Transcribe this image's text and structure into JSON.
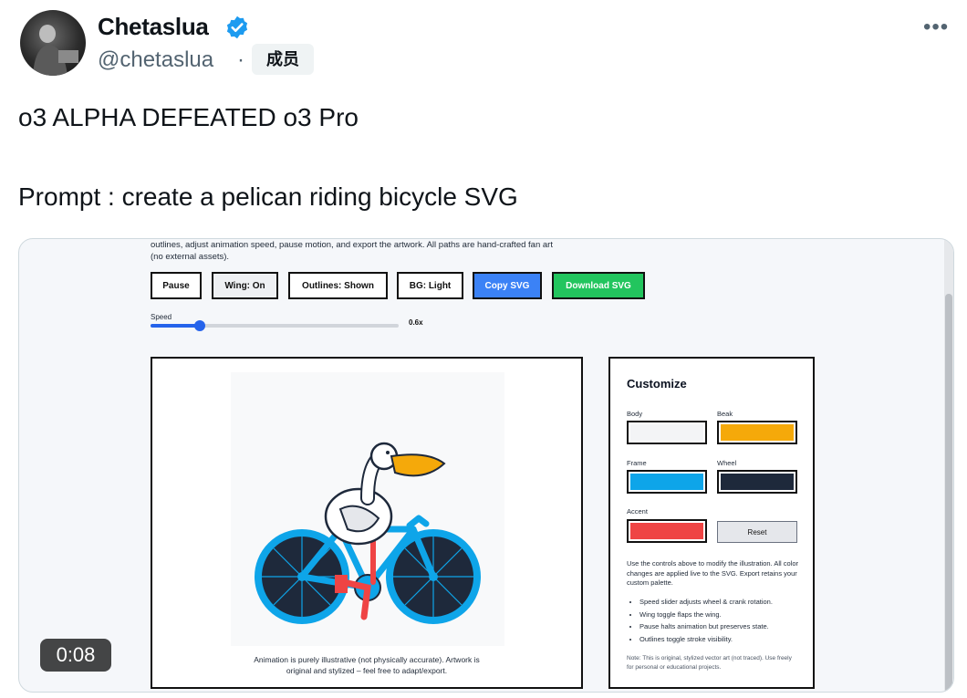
{
  "author": {
    "name": "Chetaslua",
    "handle": "@chetaslua",
    "separator": "·",
    "badge": "成员",
    "verified_color": "#1d9bf0"
  },
  "more_label": "•••",
  "tweet": {
    "line1": "o3 ALPHA DEFEATED o3 Pro",
    "line2": "Prompt : create a pelican riding bicycle SVG"
  },
  "video": {
    "timer": "0:08",
    "intro_text": "outlines, adjust animation speed, pause motion, and export the artwork. All paths are hand-crafted fan art (no external assets).",
    "buttons": {
      "pause": "Pause",
      "wing": "Wing: On",
      "outlines": "Outlines: Shown",
      "bg": "BG: Light",
      "copy": "Copy SVG",
      "download": "Download SVG"
    },
    "button_colors": {
      "copy": "#3b82f6",
      "download": "#22c55e"
    },
    "speed_label": "Speed",
    "speed_value": "0.6x",
    "speed_fraction": 0.2,
    "caption": "Animation is purely illustrative (not physically accurate). Artwork is original and stylized – feel free to adapt/export.",
    "customize": {
      "title": "Customize",
      "body_label": "Body",
      "beak_label": "Beak",
      "frame_label": "Frame",
      "wheel_label": "Wheel",
      "accent_label": "Accent",
      "reset": "Reset",
      "colors": {
        "body": "#f3f4f6",
        "beak": "#f5a90a",
        "frame": "#0ea5e9",
        "wheel": "#1e293b",
        "accent": "#ef4444"
      },
      "description": "Use the controls above to modify the illustration. All color changes are applied live to the SVG. Export retains your custom palette.",
      "bullets": [
        "Speed slider adjusts wheel & crank rotation.",
        "Wing toggle flaps the wing.",
        "Pause halts animation but preserves state.",
        "Outlines toggle stroke visibility."
      ],
      "note": "Note: This is original, stylized vector art (not traced). Use freely for personal or educational projects."
    }
  }
}
